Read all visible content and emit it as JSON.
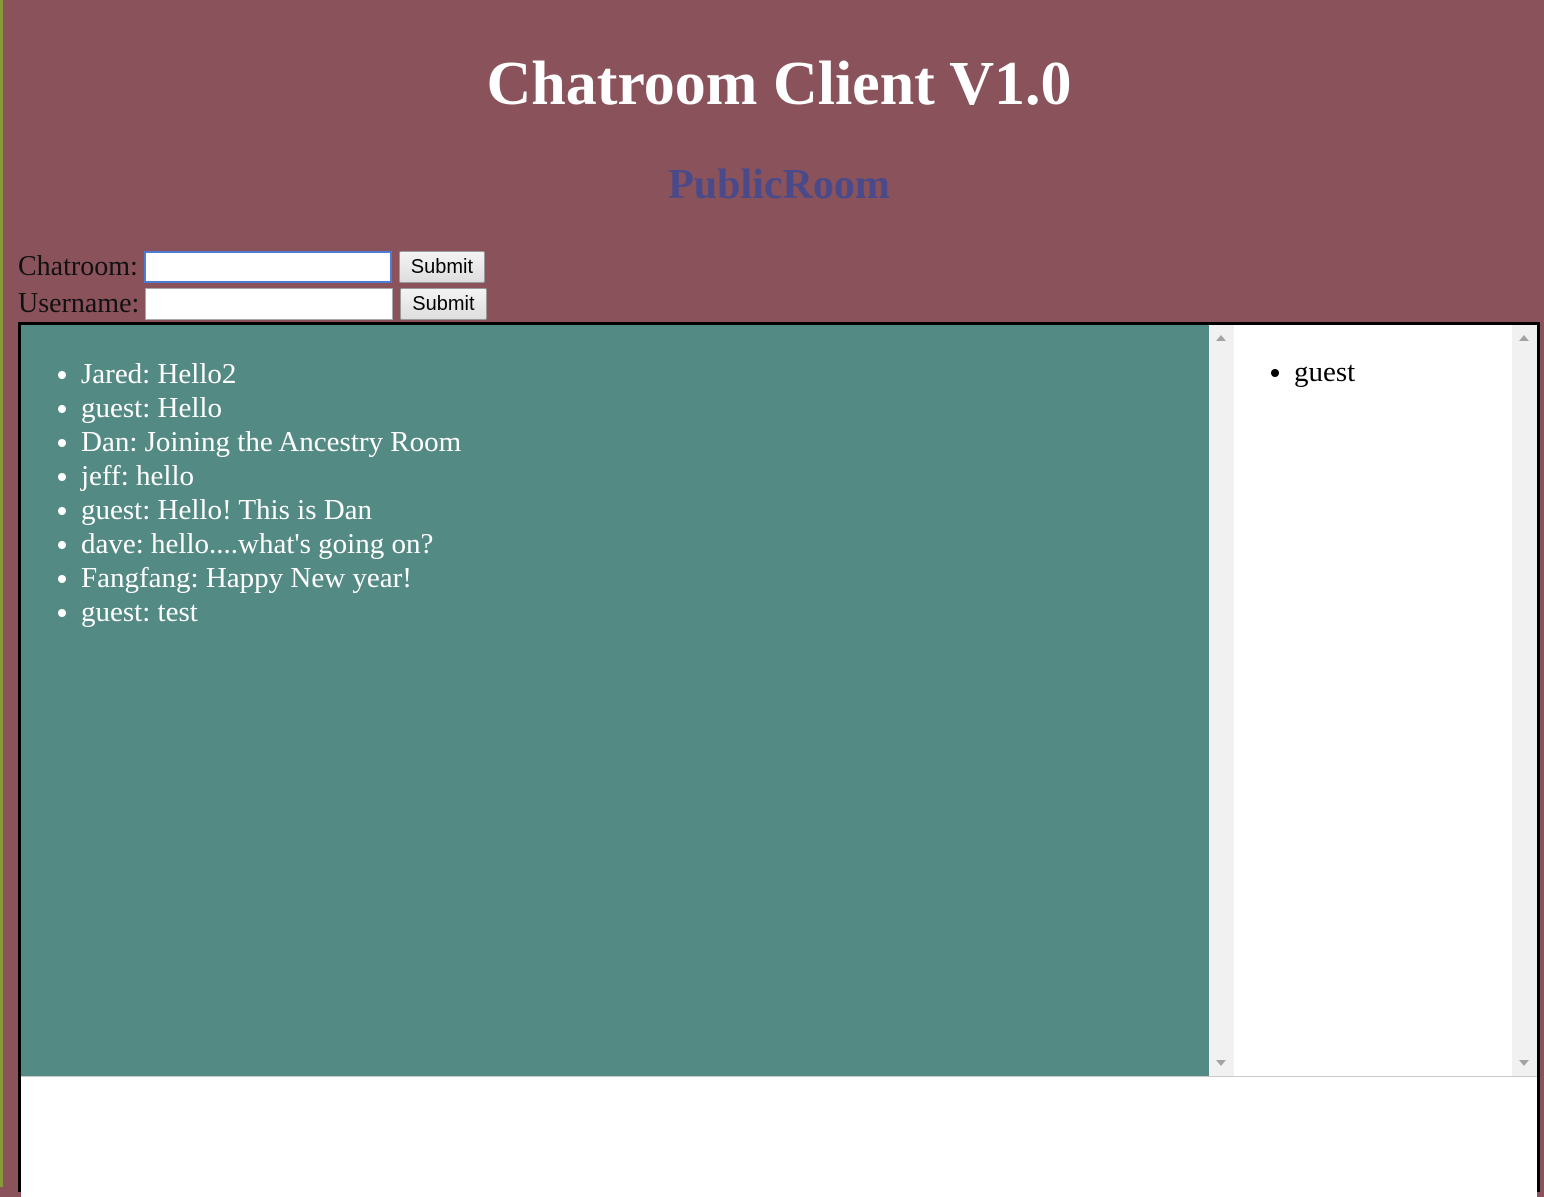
{
  "app": {
    "title": "Chatroom Client V1.0",
    "room_name": "PublicRoom"
  },
  "forms": {
    "chatroom": {
      "label": "Chatroom:",
      "value": "",
      "submit_label": "Submit"
    },
    "username": {
      "label": "Username:",
      "value": "",
      "submit_label": "Submit"
    }
  },
  "messages": [
    "Jared: Hello2",
    "guest: Hello",
    "Dan: Joining the Ancestry Room",
    "jeff: hello",
    "guest: Hello! This is Dan",
    "dave: hello....what's going on?",
    "Fangfang: Happy New year!",
    "guest: test"
  ],
  "users": [
    "guest"
  ],
  "colors": {
    "page_background": "#8a525b",
    "messages_background": "#548a84",
    "room_title": "#4a4a8a",
    "title_text": "#ffffff"
  },
  "icons": {
    "scroll_up": "triangle-up",
    "scroll_down": "triangle-down"
  }
}
